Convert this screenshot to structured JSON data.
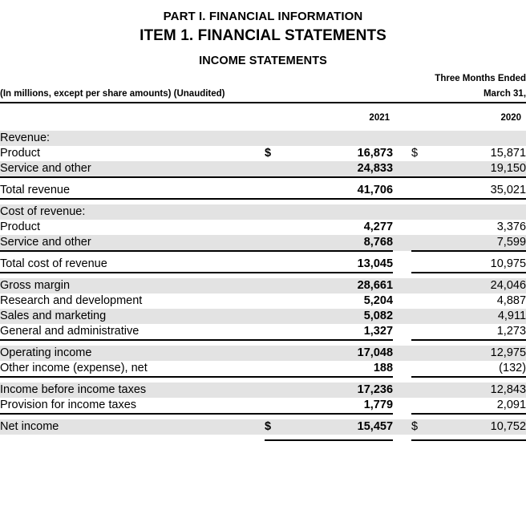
{
  "titles": {
    "part": "PART I. FINANCIAL INFORMATION",
    "item": "ITEM 1. FINANCIAL STATEMENTS",
    "statement": "INCOME STATEMENTS"
  },
  "header": {
    "note": "(In millions, except per share amounts) (Unaudited)",
    "period_line1": "Three Months Ended",
    "period_line2": "March 31,",
    "year_2021": "2021",
    "year_2020": "2020",
    "currency_symbol": "$"
  },
  "rows": [
    {
      "label": "Revenue:",
      "indent": 0,
      "v2021": "",
      "v2020": "",
      "cur": false,
      "shaded": true
    },
    {
      "label": "Product",
      "indent": 1,
      "v2021": "16,873",
      "v2020": "15,871",
      "cur": true,
      "shaded": false
    },
    {
      "label": "Service and other",
      "indent": 1,
      "v2021": "24,833",
      "v2020": "19,150",
      "cur": false,
      "shaded": true
    },
    {
      "label": "Total revenue",
      "indent": 2,
      "v2021": "41,706",
      "v2020": "35,021",
      "cur": false,
      "shaded": false
    },
    {
      "label": "Cost of revenue:",
      "indent": 0,
      "v2021": "",
      "v2020": "",
      "cur": false,
      "shaded": true
    },
    {
      "label": "Product",
      "indent": 1,
      "v2021": "4,277",
      "v2020": "3,376",
      "cur": false,
      "shaded": false
    },
    {
      "label": "Service and other",
      "indent": 1,
      "v2021": "8,768",
      "v2020": "7,599",
      "cur": false,
      "shaded": true
    },
    {
      "label": "Total cost of revenue",
      "indent": 2,
      "v2021": "13,045",
      "v2020": "10,975",
      "cur": false,
      "shaded": false
    },
    {
      "label": "Gross margin",
      "indent": 2,
      "v2021": "28,661",
      "v2020": "24,046",
      "cur": false,
      "shaded": true
    },
    {
      "label": "Research and development",
      "indent": 0,
      "v2021": "5,204",
      "v2020": "4,887",
      "cur": false,
      "shaded": false
    },
    {
      "label": "Sales and marketing",
      "indent": 0,
      "v2021": "5,082",
      "v2020": "4,911",
      "cur": false,
      "shaded": true
    },
    {
      "label": "General and administrative",
      "indent": 0,
      "v2021": "1,327",
      "v2020": "1,273",
      "cur": false,
      "shaded": false
    },
    {
      "label": "Operating income",
      "indent": 0,
      "v2021": "17,048",
      "v2020": "12,975",
      "cur": false,
      "shaded": true
    },
    {
      "label": "Other income (expense), net",
      "indent": 0,
      "v2021": "188",
      "v2020": "(132)",
      "cur": false,
      "shaded": false
    },
    {
      "label": "Income before income taxes",
      "indent": 0,
      "v2021": "17,236",
      "v2020": "12,843",
      "cur": false,
      "shaded": true
    },
    {
      "label": "Provision for income taxes",
      "indent": 0,
      "v2021": "1,779",
      "v2020": "2,091",
      "cur": false,
      "shaded": false
    },
    {
      "label": "Net income",
      "indent": 0,
      "v2021": "15,457",
      "v2020": "10,752",
      "cur": true,
      "shaded": true
    }
  ]
}
